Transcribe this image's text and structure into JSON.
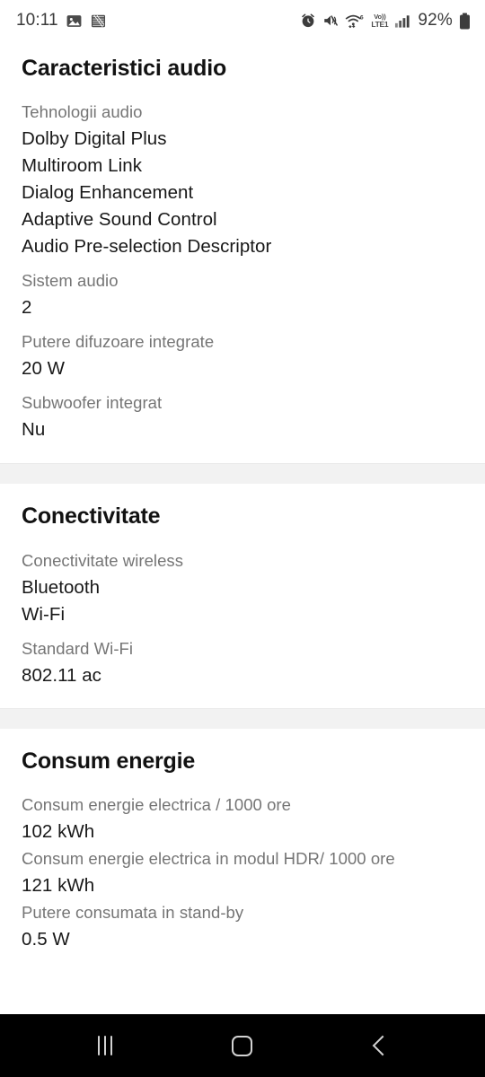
{
  "status_bar": {
    "time": "10:11",
    "left_icons": [
      "photo-gallery-icon",
      "app-notification-icon"
    ],
    "right_icons": [
      "alarm-icon",
      "sound-mute-vibrate-icon",
      "wifi-6-icon",
      "volte-icon",
      "cellular-signal-icon"
    ],
    "wifi_generation": "6",
    "volte_top": "Vo))",
    "volte_bottom": "LTE1",
    "battery_percent": "92%"
  },
  "sections": [
    {
      "title": "Caracteristici audio",
      "specs": [
        {
          "label": "Tehnologii audio",
          "values": [
            "Dolby Digital Plus",
            "Multiroom Link",
            "Dialog Enhancement",
            "Adaptive Sound Control",
            "Audio Pre-selection Descriptor"
          ]
        },
        {
          "label": "Sistem audio",
          "values": [
            "2"
          ]
        },
        {
          "label": "Putere difuzoare integrate",
          "values": [
            "20 W"
          ]
        },
        {
          "label": "Subwoofer integrat",
          "values": [
            "Nu"
          ]
        }
      ]
    },
    {
      "title": "Conectivitate",
      "specs": [
        {
          "label": "Conectivitate wireless",
          "values": [
            "Bluetooth",
            "Wi-Fi"
          ]
        },
        {
          "label": "Standard Wi-Fi",
          "values": [
            "802.11 ac"
          ]
        }
      ]
    },
    {
      "title": "Consum energie",
      "specs": [
        {
          "label": "Consum energie electrica / 1000 ore",
          "values": [
            "102 kWh"
          ]
        },
        {
          "label": "Consum energie electrica in modul HDR/ 1000 ore",
          "values": [
            "121 kWh"
          ]
        },
        {
          "label": "Putere consumata in stand-by",
          "values": [
            "0.5 W"
          ]
        }
      ]
    }
  ],
  "nav_bar": {
    "recents_label": "Recents",
    "home_label": "Home",
    "back_label": "Back"
  },
  "colors": {
    "label_gray": "#757575",
    "value_black": "#181818",
    "divider_gray": "#f2f2f2",
    "nav_background": "#000000"
  }
}
